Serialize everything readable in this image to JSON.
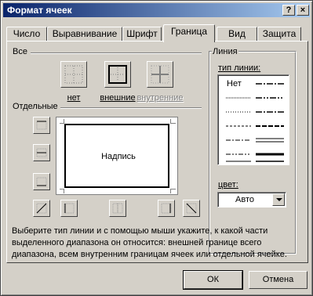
{
  "window": {
    "title": "Формат ячеек",
    "help_label": "?",
    "close_label": "×"
  },
  "tabs": [
    {
      "label": "Число"
    },
    {
      "label": "Выравнивание"
    },
    {
      "label": "Шрифт"
    },
    {
      "label": "Граница",
      "active": true
    },
    {
      "label": "Вид"
    },
    {
      "label": "Защита"
    }
  ],
  "presets": {
    "group_label": "Все",
    "none_label": "нет",
    "outline_label": "внешние",
    "inside_label": "внутренние"
  },
  "borders": {
    "group_label": "Отдельные",
    "preview_text": "Надпись"
  },
  "line": {
    "group_label": "Линия",
    "style_label": "тип линии:",
    "none_style_label": "Нет",
    "color_label": "цвет:",
    "color_value": "Авто"
  },
  "help_text": "Выберите тип линии и с помощью мыши укажите, к какой части выделенного диапазона он относится: внешней границе всего диапазона, всем внутренним границам ячеек или отдельной ячейке.",
  "buttons": {
    "ok": "ОК",
    "cancel": "Отмена"
  },
  "colors": {
    "titlebar_start": "#0a246a",
    "titlebar_end": "#a6caf0",
    "face": "#d4d0c8"
  }
}
